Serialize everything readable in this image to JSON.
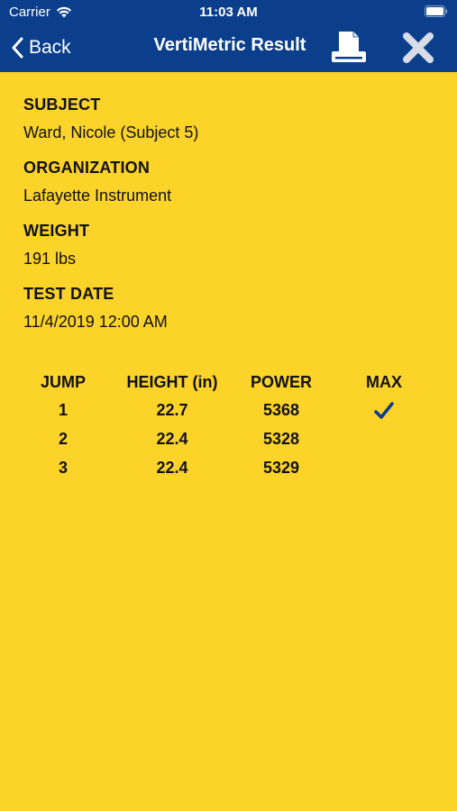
{
  "status_bar": {
    "carrier": "Carrier",
    "time": "11:03 AM"
  },
  "nav": {
    "back_label": "Back",
    "title": "VertiMetric Result",
    "print_icon": "printer-icon",
    "close_icon": "close-x-icon"
  },
  "fields": [
    {
      "label": "SUBJECT",
      "value": "Ward, Nicole (Subject 5)"
    },
    {
      "label": "ORGANIZATION",
      "value": "Lafayette Instrument"
    },
    {
      "label": "WEIGHT",
      "value": "191 lbs"
    },
    {
      "label": "TEST DATE",
      "value": "11/4/2019 12:00 AM"
    }
  ],
  "results": {
    "columns": [
      "JUMP",
      "HEIGHT (in)",
      "POWER",
      "MAX"
    ],
    "rows": [
      {
        "jump": "1",
        "height": "22.7",
        "power": "5368",
        "max": true
      },
      {
        "jump": "2",
        "height": "22.4",
        "power": "5328",
        "max": false
      },
      {
        "jump": "3",
        "height": "22.4",
        "power": "5329",
        "max": false
      }
    ]
  },
  "colors": {
    "header_bg": "#0B3F8C",
    "page_bg": "#FCD329",
    "check": "#0B3F8C"
  }
}
